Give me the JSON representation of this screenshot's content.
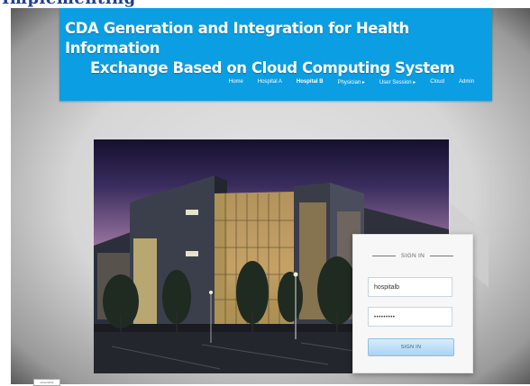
{
  "browser": {
    "partial_header_text": "Implementing"
  },
  "site": {
    "title_line1": "CDA Generation and Integration for Health Information",
    "title_line2": "Exchange Based on Cloud Computing System"
  },
  "nav": [
    {
      "label": "Home",
      "active": false
    },
    {
      "label": "Hospital A",
      "active": false
    },
    {
      "label": "Hospital B",
      "active": true
    },
    {
      "label": "Physician ▸",
      "active": false
    },
    {
      "label": "User Session ▸",
      "active": false
    },
    {
      "label": "Cloud",
      "active": false
    },
    {
      "label": "Admin",
      "active": false
    }
  ],
  "login": {
    "heading": "SIGN IN",
    "username_value": "hospitalb",
    "password_value": "•••••••••",
    "button_label": "SIGN IN"
  },
  "colors": {
    "header_bg": "#0b9ee3",
    "button_bg": "#a9d3f3"
  },
  "footer": {
    "corner_label": "screenshot"
  }
}
